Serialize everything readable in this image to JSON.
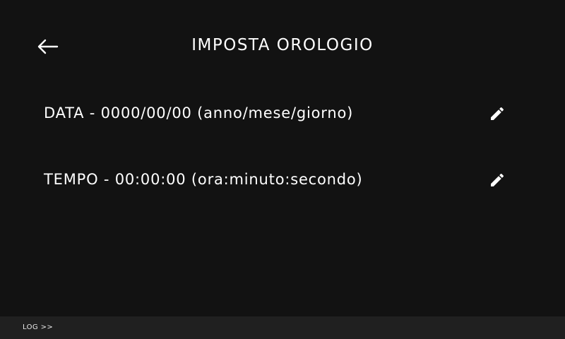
{
  "header": {
    "title": "IMPOSTA OROLOGIO",
    "back_icon": "arrow-left-icon"
  },
  "settings": [
    {
      "label": "DATA - 0000/00/00 (anno/mese/giorno)",
      "edit_icon": "pencil-icon"
    },
    {
      "label": "TEMPO - 00:00:00 (ora:minuto:secondo)",
      "edit_icon": "pencil-icon"
    }
  ],
  "footer": {
    "log_label": "LOG >>"
  },
  "colors": {
    "background": "#121212",
    "footer_background": "#202020",
    "text": "#ffffff"
  }
}
